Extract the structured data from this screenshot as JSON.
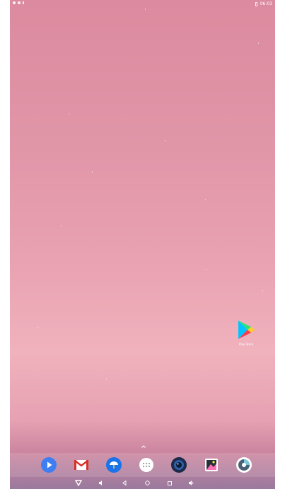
{
  "status_bar": {
    "clock": "06:03",
    "left_icons": [
      "notification-dot-icon",
      "notification-dot-icon",
      "signal-icon"
    ],
    "right_icons": [
      "battery-icon"
    ]
  },
  "desktop": {
    "shortcut": {
      "label": "Play Store",
      "icon": "play-store-icon"
    }
  },
  "dock": {
    "apps": [
      {
        "name": "media-player",
        "icon": "play-circle-icon",
        "color": "#3d7ff2"
      },
      {
        "name": "gmail",
        "icon": "gmail-icon",
        "color": "#d93025"
      },
      {
        "name": "weather",
        "icon": "cloud-umbrella-icon",
        "color": "#1a73e8"
      },
      {
        "name": "app-drawer",
        "icon": "app-drawer-icon",
        "color": "#ffffff"
      },
      {
        "name": "camera",
        "icon": "camera-lens-icon",
        "color": "#1c2b4a"
      },
      {
        "name": "gallery",
        "icon": "photo-gallery-icon",
        "color": "#ffffff"
      },
      {
        "name": "browser",
        "icon": "browser-icon",
        "color": "#ffffff"
      }
    ]
  },
  "nav_bar": {
    "buttons": [
      "hide-nav-icon",
      "volume-down-icon",
      "back-icon",
      "home-icon",
      "recents-icon",
      "volume-up-icon"
    ]
  },
  "colors": {
    "wallpaper_top": "#dc8a9f",
    "wallpaper_mid": "#f0b2bd",
    "wallpaper_bottom": "#9a7a9e"
  }
}
